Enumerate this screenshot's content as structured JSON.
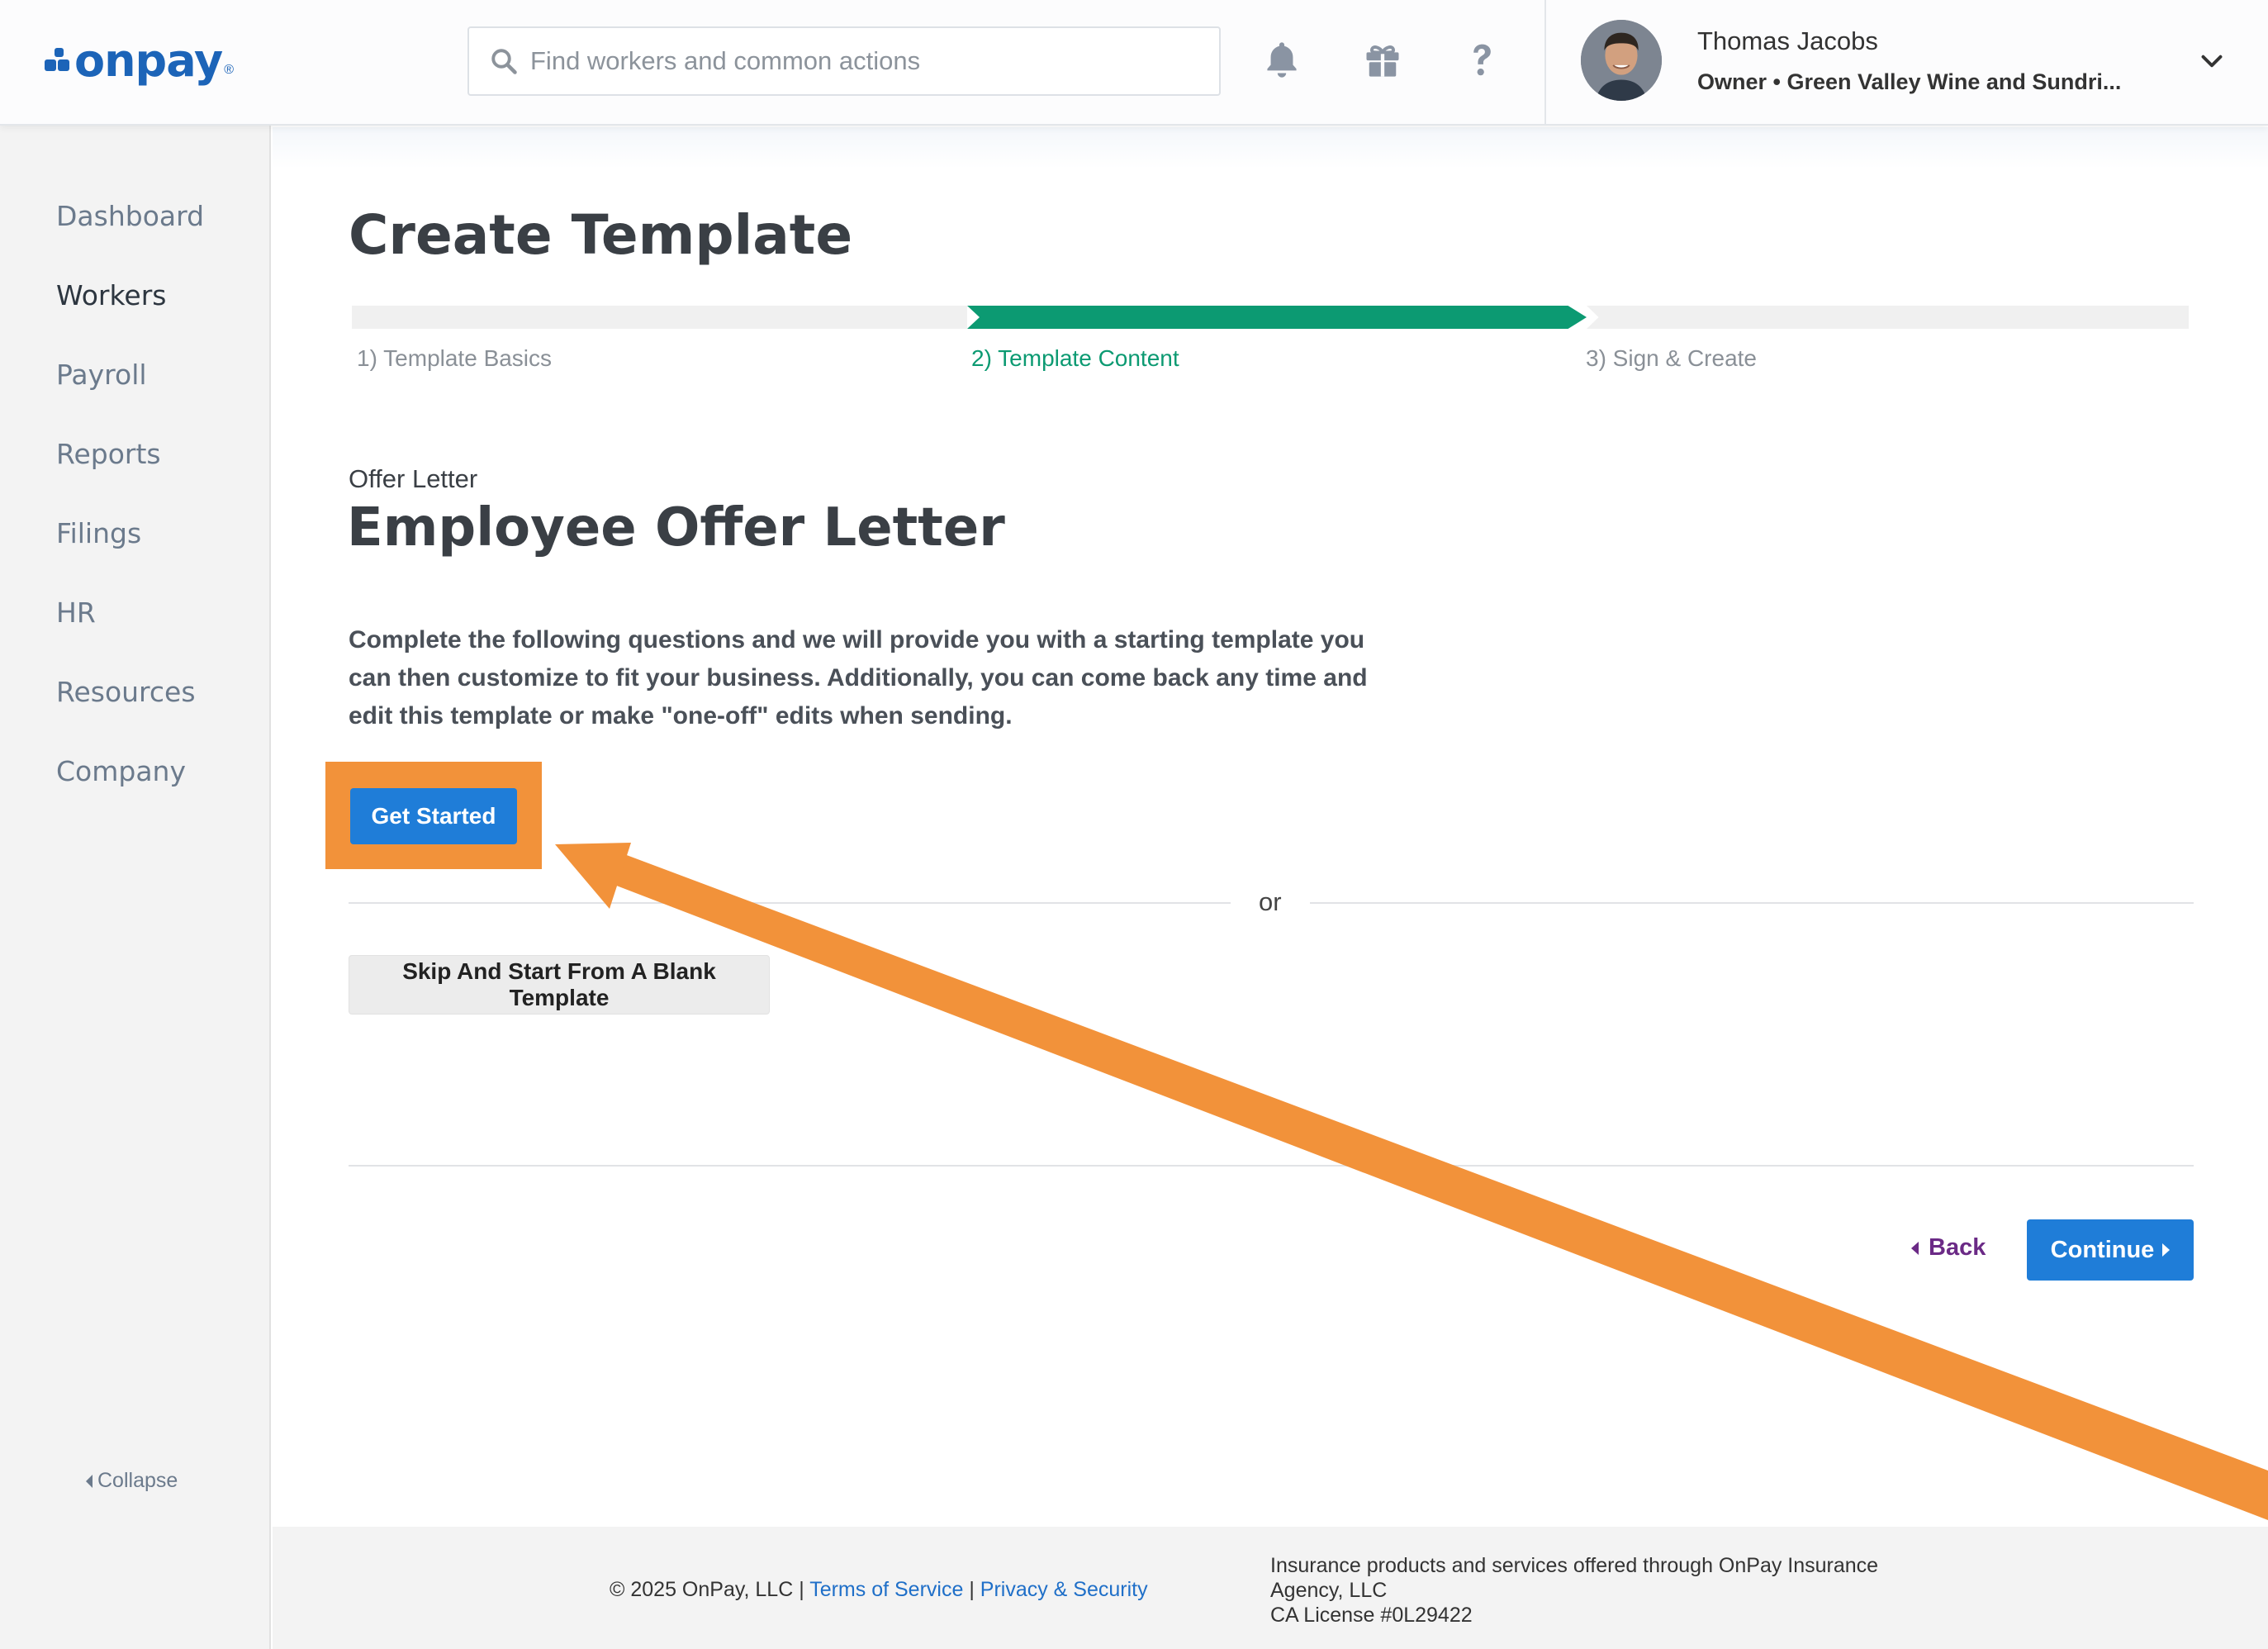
{
  "header": {
    "logo_text": "onpay",
    "logo_reg": "®",
    "search_placeholder": "Find workers and common actions",
    "user_name": "Thomas Jacobs",
    "user_role": "Owner • Green Valley Wine and Sundri..."
  },
  "sidebar": {
    "items": [
      {
        "label": "Dashboard"
      },
      {
        "label": "Workers",
        "active": true
      },
      {
        "label": "Payroll"
      },
      {
        "label": "Reports"
      },
      {
        "label": "Filings"
      },
      {
        "label": "HR"
      },
      {
        "label": "Resources"
      },
      {
        "label": "Company"
      }
    ],
    "collapse_label": "Collapse"
  },
  "main": {
    "page_title": "Create Template",
    "steps": [
      {
        "label": "1) Template Basics"
      },
      {
        "label": "2) Template Content",
        "active": true
      },
      {
        "label": "3) Sign & Create"
      }
    ],
    "offer_subtitle": "Offer Letter",
    "offer_title": "Employee Offer Letter",
    "description": "Complete the following questions and we will provide you with a starting template you can then customize to fit your business. Additionally, you can come back any time and edit this template or make \"one-off\" edits when sending.",
    "get_started_label": "Get Started",
    "or_label": "or",
    "skip_label": "Skip And Start From A Blank Template",
    "back_label": "Back",
    "continue_label": "Continue"
  },
  "footer": {
    "copyright": "© 2025 OnPay, LLC |",
    "terms_label": "Terms of Service",
    "separator": "|",
    "privacy_label": "Privacy & Security",
    "insurance_line1": "Insurance products and services offered through OnPay Insurance",
    "insurance_line2": "Agency, LLC",
    "insurance_line3": "CA License #0L29422"
  },
  "colors": {
    "brand_blue": "#1c64b8",
    "primary_button": "#1f7dd8",
    "step_active": "#0c9a72",
    "highlight_orange": "#f2923a",
    "back_link": "#6b2a86"
  }
}
